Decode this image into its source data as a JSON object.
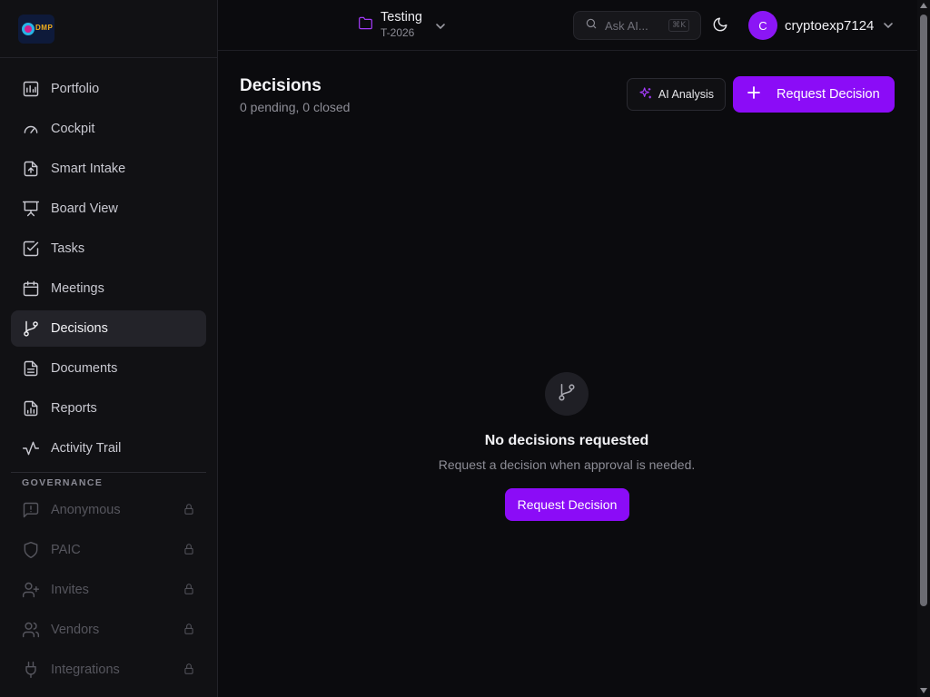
{
  "sidebar": {
    "logo_text": "DMP",
    "items": [
      {
        "label": "Portfolio",
        "icon": "portfolio-icon"
      },
      {
        "label": "Cockpit",
        "icon": "gauge-icon"
      },
      {
        "label": "Smart Intake",
        "icon": "file-upload-icon"
      },
      {
        "label": "Board View",
        "icon": "presentation-icon"
      },
      {
        "label": "Tasks",
        "icon": "checkbox-icon"
      },
      {
        "label": "Meetings",
        "icon": "calendar-icon"
      },
      {
        "label": "Decisions",
        "icon": "git-branch-icon",
        "active": true
      },
      {
        "label": "Documents",
        "icon": "document-icon"
      },
      {
        "label": "Reports",
        "icon": "report-icon"
      },
      {
        "label": "Activity Trail",
        "icon": "activity-icon"
      }
    ],
    "governance_label": "GOVERNANCE",
    "governance_items": [
      {
        "label": "Anonymous",
        "icon": "message-alert-icon",
        "locked": true
      },
      {
        "label": "PAIC",
        "icon": "shield-icon",
        "locked": true
      },
      {
        "label": "Invites",
        "icon": "user-plus-icon",
        "locked": true
      },
      {
        "label": "Vendors",
        "icon": "users-icon",
        "locked": true
      },
      {
        "label": "Integrations",
        "icon": "plug-icon",
        "locked": true
      }
    ]
  },
  "topbar": {
    "project_name": "Testing",
    "project_code": "T-2026",
    "search_placeholder": "Ask AI...",
    "search_shortcut": "⌘K",
    "user_initial": "C",
    "username": "cryptoexp7124"
  },
  "main": {
    "title": "Decisions",
    "subtitle": "0 pending, 0 closed",
    "ai_button": "AI Analysis",
    "request_button": "Request Decision",
    "empty_title": "No decisions requested",
    "empty_subtitle": "Request a decision when approval is needed.",
    "empty_button": "Request Decision"
  },
  "colors": {
    "accent": "#8b0cf7",
    "background": "#0b0b0e",
    "sidebar": "#111114"
  }
}
